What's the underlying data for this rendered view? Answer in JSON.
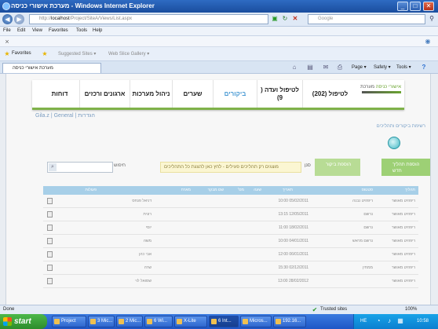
{
  "window": {
    "title": "מערכת אישורי כניסה - Windows Internet Explorer",
    "minimize": "_",
    "maximize": "□",
    "close": "✕"
  },
  "addressbar": {
    "url_prefix": "http://",
    "url_host": "localhost",
    "url_path": "/Project/SiteA/Views/List.aspx",
    "search_placeholder": "Google"
  },
  "menu": [
    "File",
    "Edit",
    "View",
    "Favorites",
    "Tools",
    "Help"
  ],
  "favorites_bar": {
    "label": "Favorites",
    "items": [
      "Suggested Sites ▾",
      "Web Slice Gallery ▾"
    ]
  },
  "tab": {
    "label": "מערכת אישורי כניסה"
  },
  "command_bar": [
    "Page ▾",
    "Safety ▾",
    "Tools ▾"
  ],
  "site": {
    "logo_text": "מערכת",
    "logo_accent": "אישורי כניסה",
    "nav": [
      {
        "label": "לטיפול (202)",
        "active": false
      },
      {
        "label": "לטיפול ועדה ( 9)",
        "active": false
      },
      {
        "label": "ביקורים",
        "active": true
      },
      {
        "label": "שערים",
        "active": false
      },
      {
        "label": "ניהול מערכות",
        "active": false
      },
      {
        "label": "ארגונים ורכזים",
        "active": false
      },
      {
        "label": "דוחות",
        "active": false
      }
    ],
    "breadcrumb": "Gila.z  |  General  |  הגדרות",
    "subheading": "רשימת ביקורים ותהליכים",
    "add_button": "הוספת תהליך חדש",
    "add_button_2": "הוספת ביקור",
    "filter_text": "מוצגים רק תהליכים פעילים - לחץ כאן להצגת כל התהליכים",
    "filter_label": "סנן",
    "search_label": "חיפוש"
  },
  "table": {
    "headers": [
      "תהליך",
      "סטטוס",
      "תאריך",
      "שעה",
      "מס׳",
      "שם מבקר",
      "מארח",
      "פעולות"
    ],
    "rows": [
      {
        "process": "ריפוזיט מאושר",
        "status": "ריפוזיט נבנה",
        "date": "10:00 05/02/2011",
        "host": "דניאל פנחס"
      },
      {
        "process": "ריפוזיט מאושר",
        "status": "נרשם",
        "date": "13:15 12/05/2011",
        "host": "רונית"
      },
      {
        "process": "ריפוזיט מאושר",
        "status": "נרשם",
        "date": "11:00 18/02/2011",
        "host": "יוסי"
      },
      {
        "process": "ריפוזיט מאושר",
        "status": "נרשם מראש",
        "date": "10:00 04/01/2011",
        "host": "משה"
      },
      {
        "process": "ריפוזיט מאושר",
        "status": "",
        "date": "12:00 06/01/2011",
        "host": "אבי כהן"
      },
      {
        "process": "ריפוזיט מאושר",
        "status": "ממתין",
        "date": "15:30 02/12/2011",
        "host": "שרה"
      },
      {
        "process": "ריפוזיט מאושר",
        "status": "",
        "date": "13:00 28/02/2012",
        "host": "שמואל לוי"
      }
    ]
  },
  "statusbar": {
    "left": "Done",
    "zone": "Trusted sites",
    "zoom": "100%"
  },
  "taskbar": {
    "start": "start",
    "tasks": [
      "Project",
      "3 Mic...",
      "2 Mic...",
      "6 Wi...",
      "X-Lite",
      "6 Int...",
      "Micros...",
      "192.16..."
    ],
    "active_index": 5,
    "lang": "HE",
    "clock": "10:58"
  }
}
